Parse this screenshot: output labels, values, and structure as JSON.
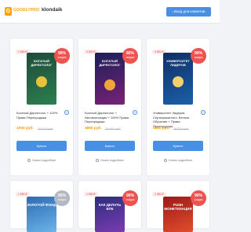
{
  "header": {
    "logo_glyph": "G",
    "logo_text": "GOODLYPRO",
    "search_term": "klondaik",
    "login_label": "Вход для клиентов"
  },
  "products": [
    {
      "price_tag": "1 550 ₽",
      "discount_value": "90%",
      "discount_label": "скидка",
      "box_text": "БОГАТЫЙ ДИРЕКТОЛОГ",
      "title": "Богатый Директолог + 100% Права Перепродажи",
      "info_glyph": "i",
      "price": "1550 руб.",
      "old_price": "15 000 руб.",
      "buy_label": "Купить",
      "notify_label": "Узнать подробнее"
    },
    {
      "price_tag": "4 800 ₽",
      "discount_value": "80%",
      "discount_label": "скидка",
      "box_text": "БОГАТЫЙ ДИРЕКТОЛОГ",
      "title": "Богатый Директолог + Автоматизация + 100% Права Перепродажи",
      "info_glyph": "i",
      "price": "4800 руб.",
      "old_price": "25 000 руб.",
      "buy_label": "Купить",
      "notify_label": "Узнать подробнее"
    },
    {
      "price_tag": "4 800 ₽",
      "discount_value": "90%",
      "discount_label": "скидка",
      "box_text": "УНИВЕРСИТЕТ ЛИДЕРОВ",
      "title": "Университет Лидеров Сертификатного. Вечное Обучение + Права Перепродажи",
      "info_glyph": "i",
      "price": "4800 руб.",
      "old_price": "48 000 руб.",
      "buy_label": "Купить",
      "notify_label": "Узнать подробнее"
    },
    {
      "price_tag": "1 550 ₽",
      "discount_value": "90%",
      "discount_label": "скидка",
      "box_text": "ЗОЛОТОЙ ФОНД"
    },
    {
      "price_tag": "1 550 ₽",
      "discount_value": "90%",
      "discount_label": "скидка",
      "box_text": "КАК ДЕЛАТЬ БТБ"
    },
    {
      "price_tag": "1 550 ₽",
      "discount_value": "90%",
      "discount_label": "скидка",
      "box_text": "PUSH МОНЕТИЗАЦИЯ"
    }
  ],
  "colors": {
    "accent": "#4a8fe6",
    "price": "#f49a0b",
    "discount": "#ef5350",
    "logo": "#f7a600"
  }
}
